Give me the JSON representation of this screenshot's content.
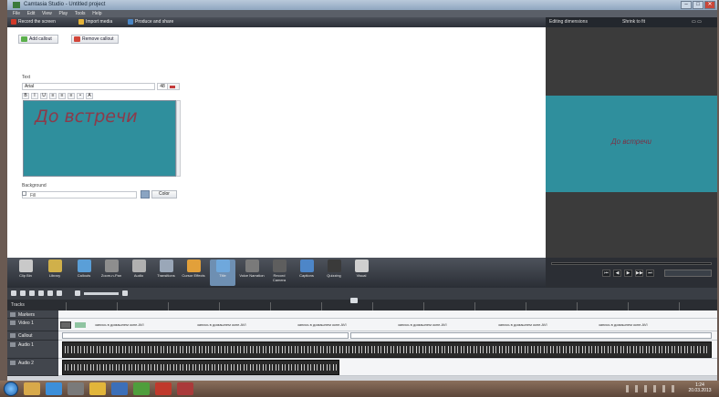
{
  "window": {
    "title": "Camtasia Studio - Untitled project"
  },
  "menu": [
    "File",
    "Edit",
    "View",
    "Play",
    "Tools",
    "Help"
  ],
  "toolbar": {
    "record": "Record the screen",
    "import": "Import media",
    "produce": "Produce and share"
  },
  "preview_header": {
    "label": "Editing dimensions",
    "zoom": "Shrink to fit"
  },
  "callout_panel": {
    "add_button": "Add callout",
    "remove_button": "Remove callout",
    "text_label": "Text",
    "font": "Arial",
    "font_size": "48",
    "caption_text": "До встречи",
    "background_label": "Background",
    "background_value": "Fill",
    "color_button": "Color"
  },
  "preview": {
    "caption_text": "До встречи",
    "background_color": "#2f8f9d"
  },
  "tasks": [
    {
      "label": "Clip Bin",
      "icon": "clip-bin-icon",
      "color": "#c9c9c9"
    },
    {
      "label": "Library",
      "icon": "library-icon",
      "color": "#d0b04a"
    },
    {
      "label": "Callouts",
      "icon": "callouts-icon",
      "color": "#5a9fd8"
    },
    {
      "label": "Zoom-n-Pan",
      "icon": "zoom-icon",
      "color": "#8e8e8e"
    },
    {
      "label": "Audio",
      "icon": "audio-icon",
      "color": "#b0b0b0"
    },
    {
      "label": "Transitions",
      "icon": "transitions-icon",
      "color": "#9aa7b8"
    },
    {
      "label": "Cursor Effects",
      "icon": "cursor-icon",
      "color": "#e2a03a"
    },
    {
      "label": "Title",
      "icon": "title-icon",
      "color": "#6fa8dc"
    },
    {
      "label": "Voice Narration",
      "icon": "mic-icon",
      "color": "#7a7a7a"
    },
    {
      "label": "Record Camera",
      "icon": "camera-icon",
      "color": "#5e5e5e"
    },
    {
      "label": "Captions",
      "icon": "captions-icon",
      "color": "#4d86c8"
    },
    {
      "label": "Quizzing",
      "icon": "quiz-icon",
      "color": "#3a3a3a"
    },
    {
      "label": "Visual",
      "icon": "visual-icon",
      "color": "#cfcfcf"
    }
  ],
  "timeline": {
    "tracks_label": "Tracks",
    "zoom_label": "Zoom",
    "tracks": [
      {
        "name": "Markers"
      },
      {
        "name": "Video 1"
      },
      {
        "name": "Callout"
      },
      {
        "name": "Audio 1"
      },
      {
        "name": "Audio 2"
      }
    ],
    "clip_labels": [
      "запись в домашнем окне.AVI",
      "запись в домашнем окне.AVI",
      "запись в домашнем окне.AVI",
      "запись в домашнем окне.AVI",
      "запись в домашнем окне.AVI",
      "запись в домашнем окне.AVI"
    ]
  },
  "taskbar": {
    "apps": [
      {
        "icon": "explorer-icon",
        "color": "#d8a94a"
      },
      {
        "icon": "ie-icon",
        "color": "#3d8fd9"
      },
      {
        "icon": "media-icon",
        "color": "#7a7a7a"
      },
      {
        "icon": "chrome-icon",
        "color": "#e2b53a"
      },
      {
        "icon": "word-icon",
        "color": "#3c6fb8"
      },
      {
        "icon": "camtasia-icon",
        "color": "#4f9e3c"
      },
      {
        "icon": "acrobat-icon",
        "color": "#c0392b"
      },
      {
        "icon": "app-icon",
        "color": "#aa3a3a"
      }
    ],
    "clock_time": "1:24",
    "clock_date": "20.03.2013"
  }
}
